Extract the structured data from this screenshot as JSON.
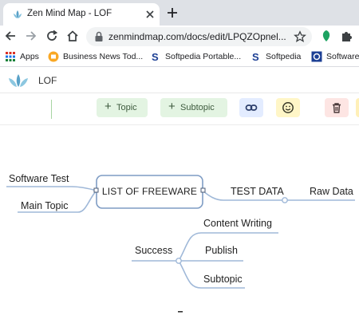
{
  "browser": {
    "tab_title": "Zen Mind Map - LOF",
    "url": "zenmindmap.com/docs/edit/LPQZOpnel...",
    "bookmarks": [
      {
        "label": "Apps",
        "icon": "apps-grid-icon"
      },
      {
        "label": "Business News Tod...",
        "icon": "news-icon"
      },
      {
        "label": "Softpedia Portable...",
        "icon": "softpedia-icon"
      },
      {
        "label": "Softpedia",
        "icon": "softpedia-icon"
      },
      {
        "label": "Software",
        "icon": "software-icon"
      }
    ]
  },
  "app": {
    "map_name": "LOF",
    "toolbar": {
      "topic_label": "Topic",
      "subtopic_label": "Subtopic"
    }
  },
  "mindmap": {
    "root": "LIST OF FREEWARE",
    "left_nodes": [
      "Software Test",
      "Main Topic"
    ],
    "right_node": "TEST DATA",
    "right_child": "Raw Data",
    "success_node": "Success",
    "success_children": [
      "Content Writing",
      "Publish",
      "Subtopic"
    ]
  },
  "colors": {
    "accent_green": "#e3f4e2",
    "branch_line": "#9fb8d8",
    "root_border": "#7e9cc4"
  }
}
